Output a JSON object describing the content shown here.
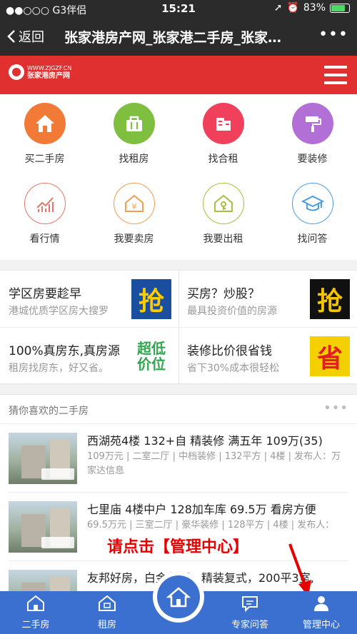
{
  "status": {
    "carrier": "●●○○○ G3伴侣",
    "time": "15:21",
    "battery": "83%",
    "battery_level": 0.83
  },
  "nav": {
    "back_label": "返回",
    "title": "张家港房产网_张家港二手房_张家…",
    "more": "•••"
  },
  "site": {
    "logo_url": "WWW.ZJGZF.CN",
    "logo_name": "张家港房产网"
  },
  "grid": [
    {
      "label": "买二手房",
      "color": "#f07a36",
      "icon": "house-icon"
    },
    {
      "label": "找租房",
      "color": "#7fbf3f",
      "icon": "bag-icon"
    },
    {
      "label": "找合租",
      "color": "#f0405c",
      "icon": "building-icon"
    },
    {
      "label": "要装修",
      "color": "#b26fd6",
      "icon": "paint-roller-icon"
    },
    {
      "label": "看行情",
      "color": "#e8756a",
      "icon": "chart-icon"
    },
    {
      "label": "我要卖房",
      "color": "#f0a050",
      "icon": "yuan-house-icon"
    },
    {
      "label": "我要出租",
      "color": "#a8bf3f",
      "icon": "key-house-icon"
    },
    {
      "label": "找问答",
      "color": "#4a9de0",
      "icon": "graduation-cap-icon"
    }
  ],
  "promos": [
    {
      "title": "学区房要趁早",
      "subtitle": "港城优质学区房大搜罗",
      "badge": "抢",
      "badge_bg": "#1a4fa0",
      "badge_fg": "#ffcc00"
    },
    {
      "title": "买房？炒股？",
      "subtitle": "最具投资价值的房源",
      "badge": "抢",
      "badge_bg": "#111111",
      "badge_fg": "#f5c400"
    },
    {
      "title": "100%真房东,真房源",
      "subtitle": "租房找房东，好又省。",
      "badge": "超低价位",
      "badge_bg": "#ffffff",
      "badge_fg": "#2fa84f"
    },
    {
      "title": "装修比价很省钱",
      "subtitle": "省下30%成本很轻松",
      "badge": "省",
      "badge_bg": "#f5d000",
      "badge_fg": "#e02020"
    }
  ],
  "listing": {
    "section_title": "猜你喜欢的二手房",
    "dots": "•••",
    "items": [
      {
        "title": "西湖苑4楼 132+自 精装修 满五年 109万(35)",
        "desc": "109万元 | 二室二厅 | 中档装修 | 132平方 | 4楼 | 发布人：万家达信息"
      },
      {
        "title": "七里庙 4楼中户 128加车库 69.5万 看房方便",
        "desc": "69.5万元 | 三室二厅 | 豪华装修 | 128平方 | 4楼 | 发布人："
      },
      {
        "title": "友邦好房，白金花园，精装复式，200平3室,",
        "desc": ""
      }
    ]
  },
  "annotation": "请点击【管理中心】",
  "tabs": [
    {
      "label": "二手房",
      "icon": "house-icon"
    },
    {
      "label": "租房",
      "icon": "rent-house-icon"
    },
    {
      "label": "专家问答",
      "icon": "chat-icon"
    },
    {
      "label": "管理中心",
      "icon": "user-icon"
    }
  ]
}
